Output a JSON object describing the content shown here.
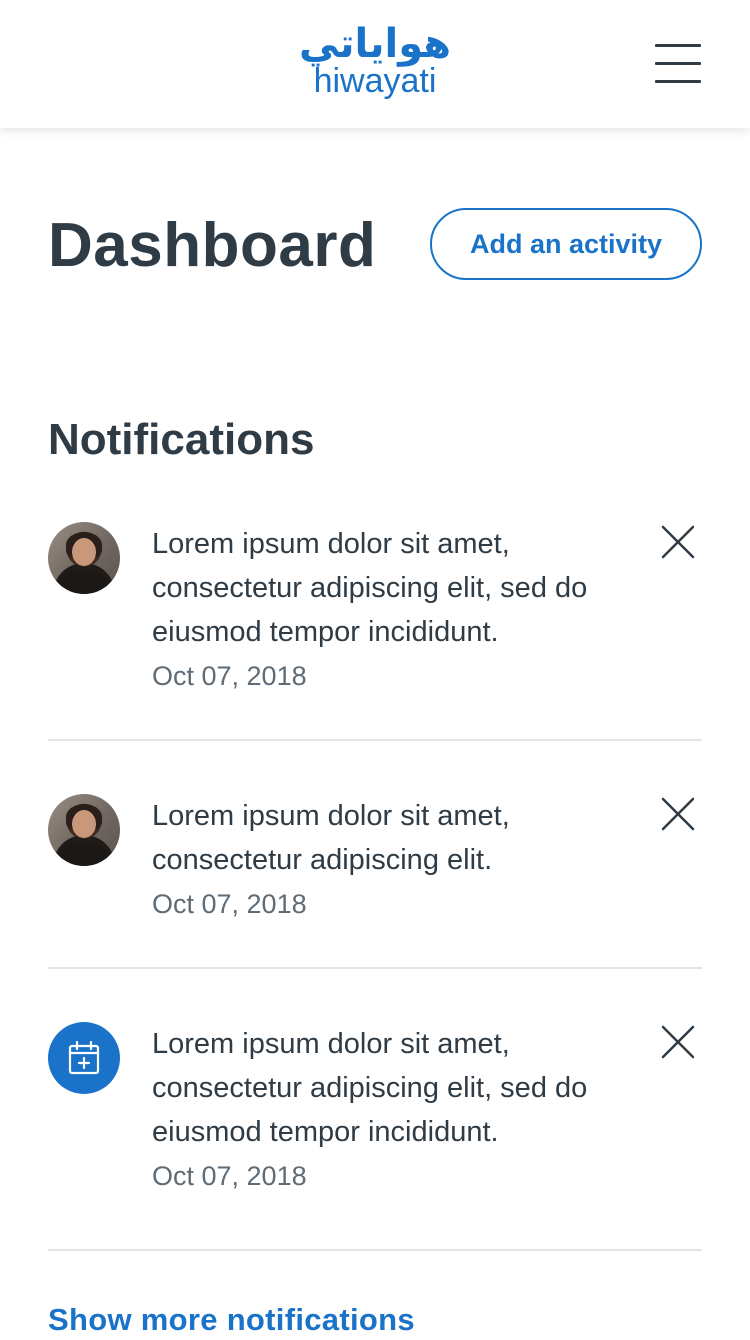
{
  "header": {
    "logo_arabic": "هواياتي",
    "logo_text": "hiwayati",
    "menu_icon": "hamburger-menu-icon"
  },
  "dashboard": {
    "title": "Dashboard",
    "add_activity_label": "Add an activity"
  },
  "notifications": {
    "title": "Notifications",
    "items": [
      {
        "avatar": "user-photo",
        "text": "Lorem ipsum dolor sit amet, consectetur adipiscing elit, sed do eiusmod tempor incididunt.",
        "date": "Oct 07, 2018"
      },
      {
        "avatar": "user-photo",
        "text": "Lorem ipsum dolor sit amet, consectetur adipiscing elit.",
        "date": "Oct 07, 2018"
      },
      {
        "avatar": "calendar-add-icon",
        "text": "Lorem ipsum dolor sit amet, consectetur adipiscing elit, sed do eiusmod tempor incididunt.",
        "date": "Oct 07, 2018"
      }
    ],
    "show_more_label": "Show more notifications"
  },
  "colors": {
    "accent": "#1a73c8",
    "text": "#2f3b45",
    "muted": "#5f6b75",
    "divider": "#e2e5e8"
  }
}
